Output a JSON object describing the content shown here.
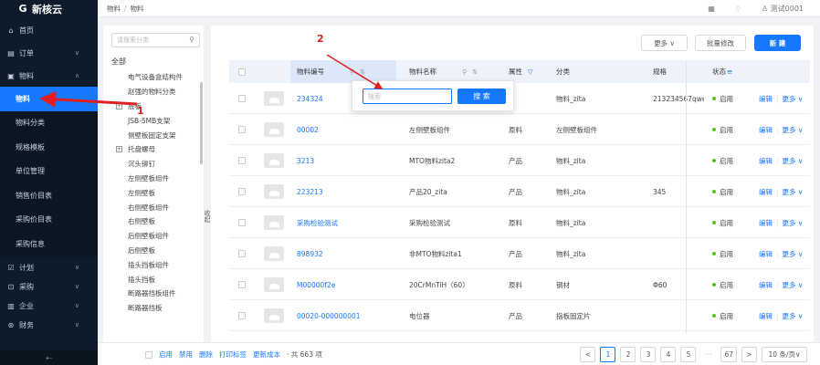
{
  "app": {
    "name": "新核云"
  },
  "breadcrumb": {
    "parent": "物料",
    "sep": "/",
    "current": "物料"
  },
  "topbar": {
    "user": "测试0001"
  },
  "sidebar": {
    "home": "首页",
    "order": "订单",
    "material": "物料",
    "sub_items": [
      "物料",
      "物料分类",
      "规格模板",
      "单位管理",
      "销售价目表",
      "采购价目表",
      "采购信息"
    ],
    "plan": "计划",
    "purchase": "采购",
    "enterprise": "企业",
    "finance": "财务",
    "collapse": "⇠"
  },
  "tree": {
    "search_placeholder": "请搜索分类",
    "root": "全部",
    "nodes": [
      {
        "label": "电气设备盒结构件",
        "expandable": false
      },
      {
        "label": "赵强的物料分类",
        "expandable": false
      },
      {
        "label": "底板",
        "expandable": true
      },
      {
        "label": "JSB-5MB支架",
        "expandable": false
      },
      {
        "label": "侧壁板固定支架",
        "expandable": false
      },
      {
        "label": "托盘螺母",
        "expandable": true
      },
      {
        "label": "沉头铆钉",
        "expandable": false
      },
      {
        "label": "左侧壁板组件",
        "expandable": false
      },
      {
        "label": "左侧壁板",
        "expandable": false
      },
      {
        "label": "右侧壁板组件",
        "expandable": false
      },
      {
        "label": "右侧壁板",
        "expandable": false
      },
      {
        "label": "后侧壁板组件",
        "expandable": false
      },
      {
        "label": "后侧壁板",
        "expandable": false
      },
      {
        "label": "插头挡板组件",
        "expandable": false
      },
      {
        "label": "插头挡板",
        "expandable": false
      },
      {
        "label": "断路器挡板组件",
        "expandable": false
      },
      {
        "label": "断路器挡板",
        "expandable": false
      }
    ],
    "collapse_label": "收起"
  },
  "toolbar": {
    "more": "更多 ∨",
    "batch_edit": "批量修改",
    "new": "新 建"
  },
  "table": {
    "headers": {
      "code": "物料编号",
      "name": "物料名称",
      "attr": "属性",
      "category": "分类",
      "spec": "规格",
      "status": "状态",
      "filter_icon": "▽",
      "status_icon": "≡"
    },
    "rows": [
      {
        "code": "234324",
        "name": "",
        "attr": "",
        "category": "物料_zita",
        "spec": "213234567qwe",
        "status": "启用"
      },
      {
        "code": "00002",
        "name": "左侧壁板组件",
        "attr": "原料",
        "category": "左侧壁板组件",
        "spec": "",
        "status": "启用"
      },
      {
        "code": "3213",
        "name": "MTO物料zita2",
        "attr": "产品",
        "category": "物料_zita",
        "spec": "",
        "status": "启用"
      },
      {
        "code": "223213",
        "name": "产品20_zita",
        "attr": "产品",
        "category": "物料_zita",
        "spec": "345",
        "status": "启用"
      },
      {
        "code": "采购检验测试",
        "name": "采购检验测试",
        "attr": "原料",
        "category": "物料_zita",
        "spec": "",
        "status": "启用"
      },
      {
        "code": "898932",
        "name": "非MTO物料zita1",
        "attr": "产品",
        "category": "物料_zita",
        "spec": "",
        "status": "启用"
      },
      {
        "code": "M00000f2e",
        "name": "20CrMnTiH（60）",
        "attr": "原料",
        "category": "钢材",
        "spec": "Φ60",
        "status": "启用"
      },
      {
        "code": "00020-000000001",
        "name": "电位器",
        "attr": "产品",
        "category": "指板固定片",
        "spec": "",
        "status": "启用"
      }
    ],
    "action_edit": "编辑",
    "action_more": "更多 ∨"
  },
  "popup": {
    "placeholder": "搜索",
    "button": "搜 索"
  },
  "footer": {
    "enable": "启用",
    "disable": "禁用",
    "delete": "删除",
    "print": "打印标签",
    "update_cost": "更新成本",
    "total": "· 共 663 项"
  },
  "pager": {
    "prev": "<",
    "pages": [
      "1",
      "2",
      "3",
      "4",
      "5"
    ],
    "ellipsis": "···",
    "last": "67",
    "next": ">",
    "size": "10 条/页∨"
  },
  "annotations": {
    "label1": "1",
    "label2": "2",
    "color": "#e02020"
  },
  "colors": {
    "sidebar": "#0d1b2a",
    "primary": "#1677ff",
    "status": "#52c41a"
  }
}
